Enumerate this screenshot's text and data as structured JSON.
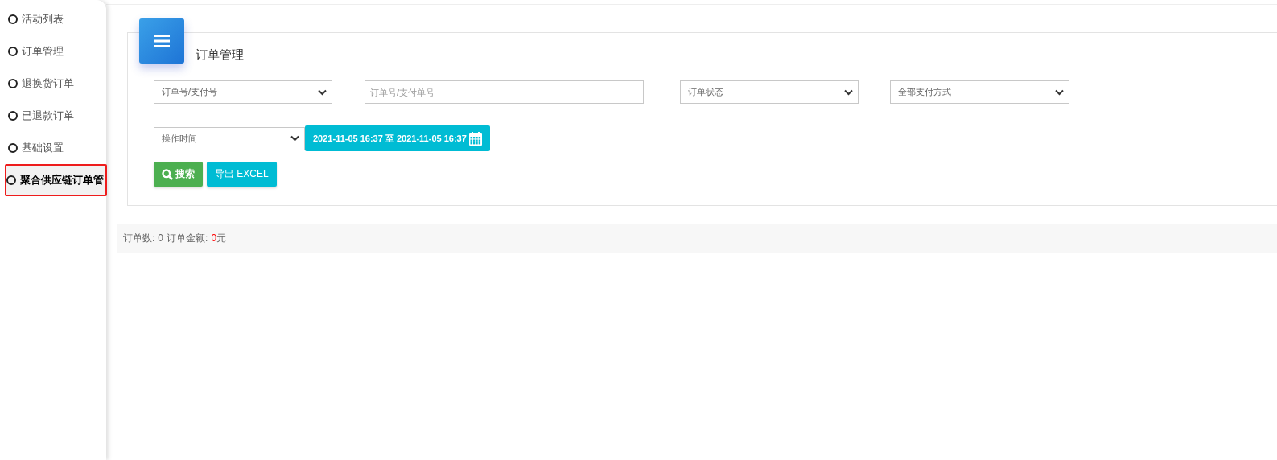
{
  "sidebar": {
    "items": [
      {
        "label": "活动列表",
        "selected": false
      },
      {
        "label": "订单管理",
        "selected": false
      },
      {
        "label": "退换货订单",
        "selected": false
      },
      {
        "label": "已退款订单",
        "selected": false
      },
      {
        "label": "基础设置",
        "selected": false
      },
      {
        "label": "聚合供应链订单管",
        "selected": true
      }
    ]
  },
  "panel": {
    "title": "订单管理",
    "filters_row_1": [
      {
        "kind": "select",
        "value": "订单号/支付号"
      },
      {
        "kind": "input",
        "placeholder": "订单号/支付单号"
      },
      {
        "kind": "select",
        "value": "订单状态"
      },
      {
        "kind": "select",
        "value": "全部支付方式"
      }
    ],
    "time_select": {
      "value": "操作时间"
    },
    "date_range": "2021-11-05 16:37 至 2021-11-05 16:37",
    "buttons": [
      {
        "kind": "search",
        "label": "搜索"
      },
      {
        "kind": "export",
        "label": "导出 EXCEL"
      }
    ]
  },
  "summary": {
    "count_label": "订单数:",
    "count": "0",
    "amount_label": "订单金额:",
    "amount": "0",
    "unit": "元"
  }
}
